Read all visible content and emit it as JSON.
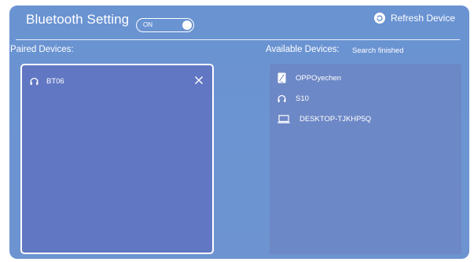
{
  "header": {
    "title": "Bluetooth Setting",
    "toggle_label": "ON",
    "refresh_label": "Refresh Device"
  },
  "paired": {
    "label": "Paired Devices:",
    "devices": [
      {
        "name": "BT06",
        "icon": "headphones-icon"
      }
    ]
  },
  "available": {
    "label": "Available Devices:",
    "status": "Search finished",
    "devices": [
      {
        "name": "OPPOyechen",
        "icon": "phone-icon"
      },
      {
        "name": "S10",
        "icon": "headphones-icon"
      },
      {
        "name": "DESKTOP-TJKHP5Q",
        "icon": "laptop-icon"
      }
    ]
  },
  "colors": {
    "panel": "#6a93d2",
    "paired_box": "#6177c3",
    "available_box": "#6d88c6",
    "text": "#ffffff"
  }
}
